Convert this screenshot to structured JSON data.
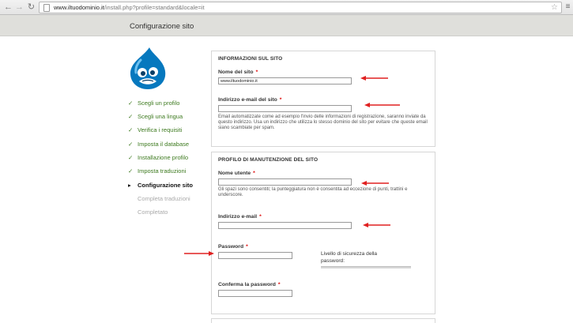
{
  "browser": {
    "url_host": "www.iltuodominio.it",
    "url_path": "/install.php?profile=standard&locale=it"
  },
  "header": {
    "title": "Configurazione sito"
  },
  "steps": [
    {
      "label": "Scegli un profilo",
      "status": "done"
    },
    {
      "label": "Scegli una lingua",
      "status": "done"
    },
    {
      "label": "Verifica i requisiti",
      "status": "done"
    },
    {
      "label": "Imposta il database",
      "status": "done"
    },
    {
      "label": "Installazione profilo",
      "status": "done"
    },
    {
      "label": "Imposta traduzioni",
      "status": "done"
    },
    {
      "label": "Configurazione sito",
      "status": "active"
    },
    {
      "label": "Completa traduzioni",
      "status": "todo"
    },
    {
      "label": "Completato",
      "status": "todo"
    }
  ],
  "site_info": {
    "legend": "INFORMAZIONI SUL SITO",
    "site_name_label": "Nome del sito",
    "site_name_value": "www.iltuodominio.it",
    "site_email_label": "Indirizzo e-mail del sito",
    "site_email_value": "",
    "site_email_desc": "Email automatizzate come ad esempio l'invio delle informazioni di registrazione, saranno inviate da questo indirizzo. Usa un indirizzo che utilizza lo stesso dominio del sito per evitare che queste email siano scambiate per spam."
  },
  "maintenance": {
    "legend": "PROFILO DI MANUTENZIONE DEL SITO",
    "username_label": "Nome utente",
    "username_value": "",
    "username_desc": "Gli spazi sono consentiti; la punteggiatura non è consentita ad eccezione di punti, trattini e underscore.",
    "email_label": "Indirizzo e-mail",
    "email_value": "",
    "password_label": "Password",
    "password_value": "",
    "strength_label": "Livello di sicurezza della password:",
    "confirm_label": "Conferma la password",
    "confirm_value": ""
  },
  "required_marker": "*",
  "colors": {
    "step_done": "#3d7a1f",
    "required": "#dd0000",
    "arrow": "#e02020",
    "header_bg": "#dfdfdb",
    "drupal_blue": "#0678be"
  }
}
